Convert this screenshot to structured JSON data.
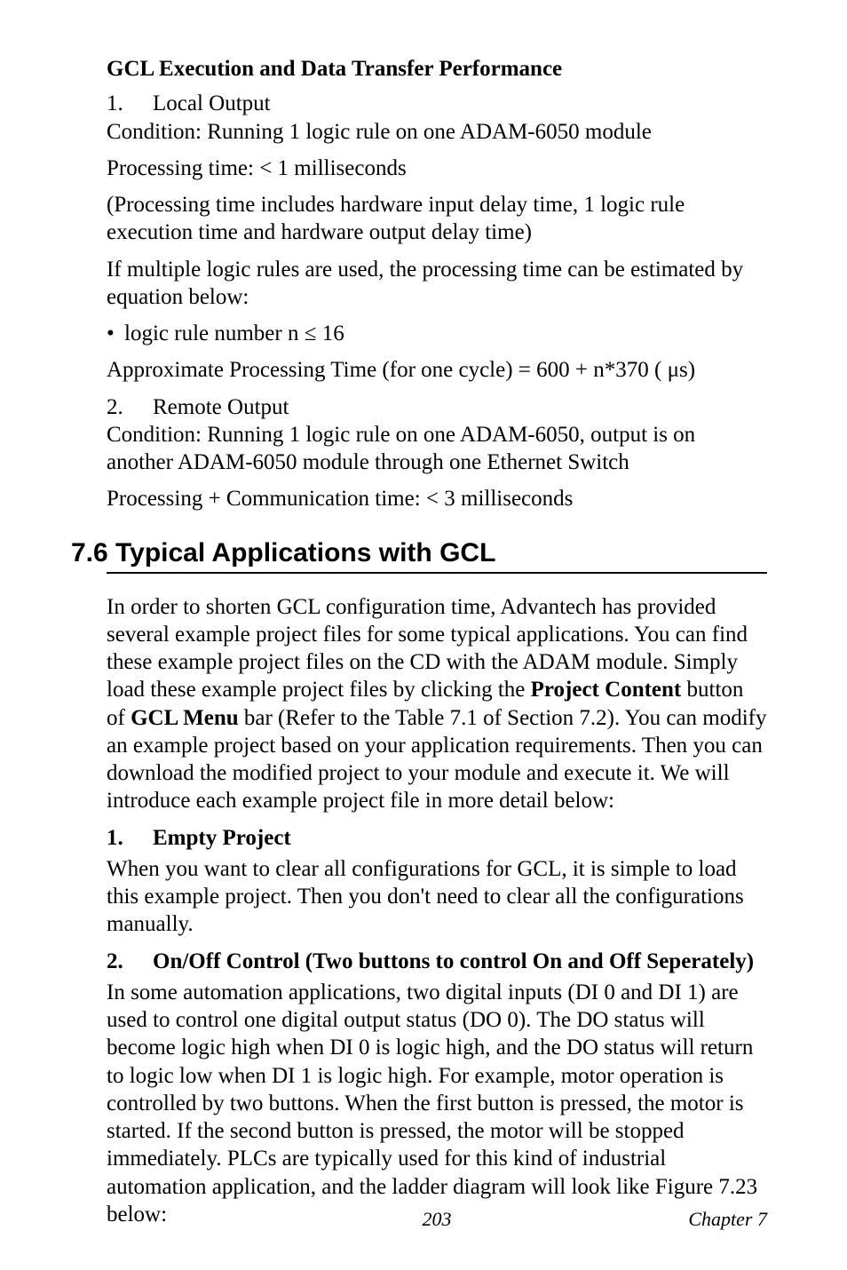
{
  "heading1": "GCL Execution and Data Transfer Performance",
  "item1_num": "1.",
  "item1_label": "Local Output",
  "item1_cond": "Condition: Running 1 logic rule on one ADAM-6050 module",
  "proc_time": "Processing time: < 1 milliseconds",
  "proc_note": "(Processing time includes hardware input delay time, 1 logic rule execution time and hardware output delay time)",
  "multi_rule": "If multiple logic rules are used, the processing time can be estimated by equation below:",
  "bullet_dot": "•",
  "bullet_rule": "logic rule number n ≤ 16",
  "approx_eq": "Approximate Processing Time (for one cycle) = 600 + n*370 ( μs)",
  "item2_num": "2.",
  "item2_label": "Remote Output",
  "item2_cond": "Condition: Running 1 logic rule on one ADAM-6050, output is on another ADAM-6050 module through one Ethernet Switch",
  "proc_comm": "Processing + Communication time: < 3 milliseconds",
  "section_title": "7.6  Typical Applications with GCL",
  "para1_a": "In order to shorten GCL configuration time, Advantech has provided several example project files for some typical applications. You can find these example project files on the CD with the ADAM module. Simply load these example project files by clicking the ",
  "para1_b": "Project Content",
  "para1_c": " button of ",
  "para1_d": "GCL Menu",
  "para1_e": " bar (Refer to the Table 7.1 of Section 7.2). You can modify an example project based on your application requirements. Then you can download the modified project to your module and execute it. We will introduce each example project file in more detail below:",
  "sub1_num": "1.",
  "sub1_label": "Empty Project",
  "sub1_body": "When you want to clear all configurations for GCL, it is simple to load this example project. Then you don't need to clear all the configurations manually.",
  "sub2_num": "2.",
  "sub2_label": "On/Off Control (Two buttons to control On and Off Seperately)",
  "sub2_body": "In some automation applications, two digital inputs (DI 0 and DI 1) are used to control one digital output status (DO 0). The DO status will become logic high when DI 0 is logic high, and the DO status will return to logic low when DI 1 is logic high. For example, motor operation is controlled by two buttons. When the first button is pressed, the motor is started. If the second button is pressed, the motor will be stopped immediately. PLCs are typically used for this kind of industrial automation application, and the ladder diagram will look like Figure 7.23 below:",
  "footer_page": "203",
  "footer_chapter": "Chapter 7"
}
